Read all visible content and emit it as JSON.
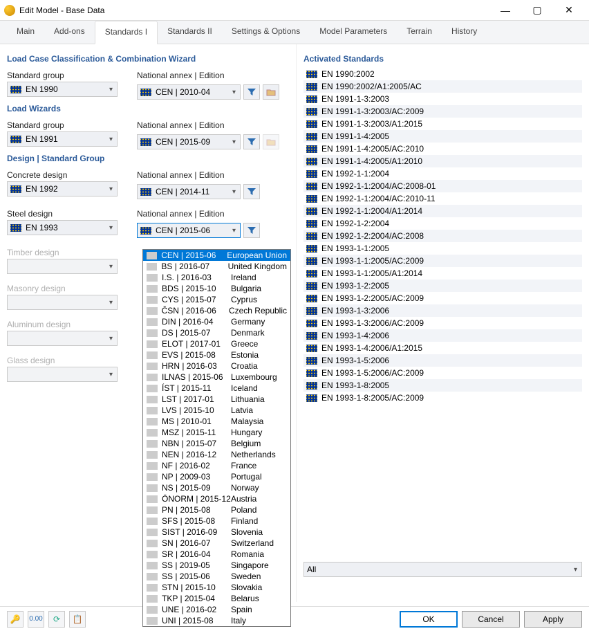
{
  "window": {
    "title": "Edit Model - Base Data"
  },
  "tabs": [
    "Main",
    "Add-ons",
    "Standards I",
    "Standards II",
    "Settings & Options",
    "Model Parameters",
    "Terrain",
    "History"
  ],
  "active_tab": 2,
  "left": {
    "sec1": {
      "title": "Load Case Classification & Combination Wizard",
      "std_lbl": "Standard group",
      "std_val": "EN 1990",
      "na_lbl": "National annex | Edition",
      "na_val": "CEN | 2010-04"
    },
    "sec2": {
      "title": "Load Wizards",
      "std_lbl": "Standard group",
      "std_val": "EN 1991",
      "na_lbl": "National annex | Edition",
      "na_val": "CEN | 2015-09"
    },
    "sec3": {
      "title": "Design | Standard Group",
      "concrete_lbl": "Concrete design",
      "concrete_std": "EN 1992",
      "concrete_na_lbl": "National annex | Edition",
      "concrete_na": "CEN | 2014-11",
      "steel_lbl": "Steel design",
      "steel_std": "EN 1993",
      "steel_na_lbl": "National annex | Edition",
      "steel_na": "CEN | 2015-06",
      "timber_lbl": "Timber design",
      "masonry_lbl": "Masonry design",
      "aluminum_lbl": "Aluminum design",
      "glass_lbl": "Glass design"
    }
  },
  "dropdown": [
    {
      "code": "CEN | 2015-06",
      "ctry": "European Union"
    },
    {
      "code": "BS | 2016-07",
      "ctry": "United Kingdom"
    },
    {
      "code": "I.S. | 2016-03",
      "ctry": "Ireland"
    },
    {
      "code": "BDS | 2015-10",
      "ctry": "Bulgaria"
    },
    {
      "code": "CYS | 2015-07",
      "ctry": "Cyprus"
    },
    {
      "code": "ČSN | 2016-06",
      "ctry": "Czech Republic"
    },
    {
      "code": "DIN | 2016-04",
      "ctry": "Germany"
    },
    {
      "code": "DS | 2015-07",
      "ctry": "Denmark"
    },
    {
      "code": "ELOT | 2017-01",
      "ctry": "Greece"
    },
    {
      "code": "EVS | 2015-08",
      "ctry": "Estonia"
    },
    {
      "code": "HRN | 2016-03",
      "ctry": "Croatia"
    },
    {
      "code": "ILNAS | 2015-06",
      "ctry": "Luxembourg"
    },
    {
      "code": "ÍST | 2015-11",
      "ctry": "Iceland"
    },
    {
      "code": "LST | 2017-01",
      "ctry": "Lithuania"
    },
    {
      "code": "LVS | 2015-10",
      "ctry": "Latvia"
    },
    {
      "code": "MS | 2010-01",
      "ctry": "Malaysia"
    },
    {
      "code": "MSZ | 2015-11",
      "ctry": "Hungary"
    },
    {
      "code": "NBN | 2015-07",
      "ctry": "Belgium"
    },
    {
      "code": "NEN | 2016-12",
      "ctry": "Netherlands"
    },
    {
      "code": "NF | 2016-02",
      "ctry": "France"
    },
    {
      "code": "NP | 2009-03",
      "ctry": "Portugal"
    },
    {
      "code": "NS | 2015-09",
      "ctry": "Norway"
    },
    {
      "code": "ÖNORM | 2015-12",
      "ctry": "Austria"
    },
    {
      "code": "PN | 2015-08",
      "ctry": "Poland"
    },
    {
      "code": "SFS | 2015-08",
      "ctry": "Finland"
    },
    {
      "code": "SIST | 2016-09",
      "ctry": "Slovenia"
    },
    {
      "code": "SN | 2016-07",
      "ctry": "Switzerland"
    },
    {
      "code": "SR | 2016-04",
      "ctry": "Romania"
    },
    {
      "code": "SS | 2019-05",
      "ctry": "Singapore"
    },
    {
      "code": "SS | 2015-06",
      "ctry": "Sweden"
    },
    {
      "code": "STN | 2015-10",
      "ctry": "Slovakia"
    },
    {
      "code": "TKP | 2015-04",
      "ctry": "Belarus"
    },
    {
      "code": "UNE | 2016-02",
      "ctry": "Spain"
    },
    {
      "code": "UNI | 2015-08",
      "ctry": "Italy"
    }
  ],
  "right": {
    "title": "Activated Standards",
    "all": "All",
    "items": [
      "EN 1990:2002",
      "EN 1990:2002/A1:2005/AC",
      "EN 1991-1-3:2003",
      "EN 1991-1-3:2003/AC:2009",
      "EN 1991-1-3:2003/A1:2015",
      "EN 1991-1-4:2005",
      "EN 1991-1-4:2005/AC:2010",
      "EN 1991-1-4:2005/A1:2010",
      "EN 1992-1-1:2004",
      "EN 1992-1-1:2004/AC:2008-01",
      "EN 1992-1-1:2004/AC:2010-11",
      "EN 1992-1-1:2004/A1:2014",
      "EN 1992-1-2:2004",
      "EN 1992-1-2:2004/AC:2008",
      "EN 1993-1-1:2005",
      "EN 1993-1-1:2005/AC:2009",
      "EN 1993-1-1:2005/A1:2014",
      "EN 1993-1-2:2005",
      "EN 1993-1-2:2005/AC:2009",
      "EN 1993-1-3:2006",
      "EN 1993-1-3:2006/AC:2009",
      "EN 1993-1-4:2006",
      "EN 1993-1-4:2006/A1:2015",
      "EN 1993-1-5:2006",
      "EN 1993-1-5:2006/AC:2009",
      "EN 1993-1-8:2005",
      "EN 1993-1-8:2005/AC:2009"
    ]
  },
  "buttons": {
    "ok": "OK",
    "cancel": "Cancel",
    "apply": "Apply"
  }
}
